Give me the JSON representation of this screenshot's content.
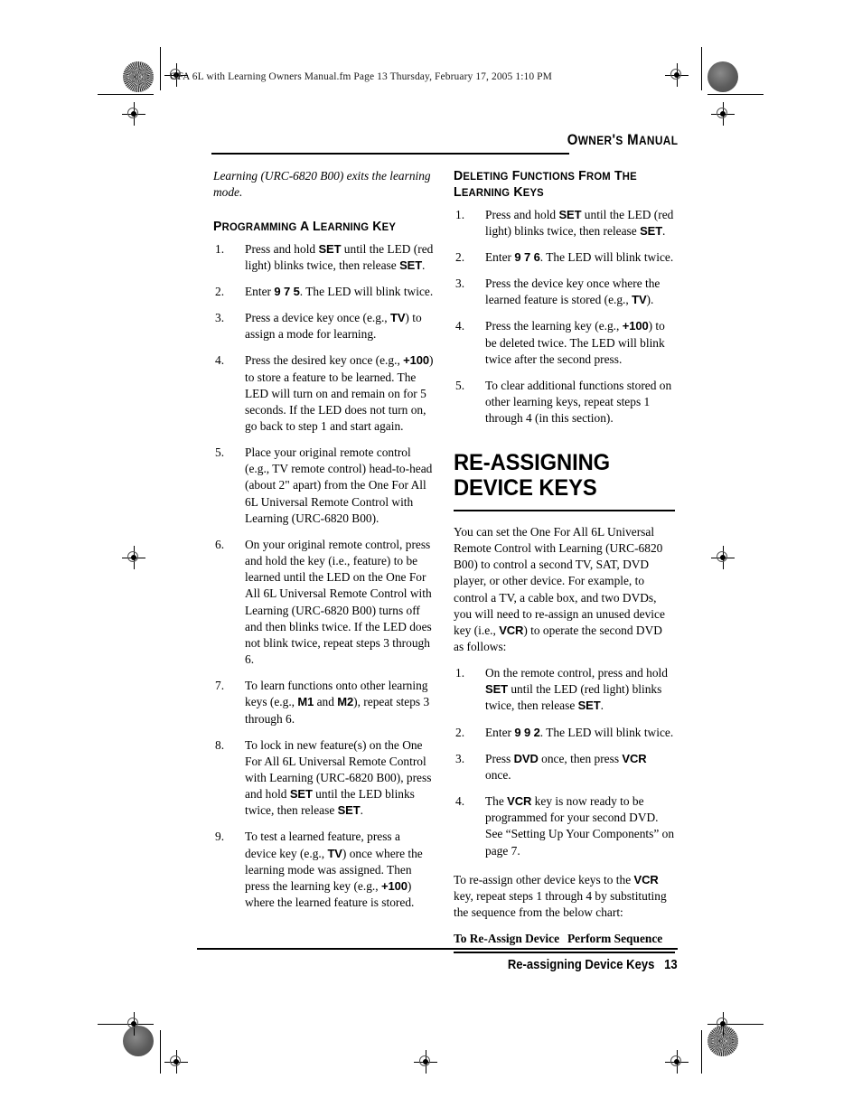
{
  "page": {
    "file_header": "OFA 6L with Learning Owners Manual.fm  Page 13  Thursday, February 17, 2005  1:10 PM",
    "running_head": "Owner's Manual",
    "footer_section": "Re-assigning Device Keys",
    "footer_page_number": "13"
  },
  "left_column": {
    "intro_italic": "Learning (URC-6820 B00) exits the learning mode.",
    "subhead": "Programming a Learning Key",
    "steps": [
      {
        "num": "1.",
        "parts": [
          {
            "t": "Press and hold "
          },
          {
            "t": "SET",
            "k": true
          },
          {
            "t": " until the LED (red light) blinks twice, then release "
          },
          {
            "t": "SET",
            "k": true
          },
          {
            "t": "."
          }
        ]
      },
      {
        "num": "2.",
        "parts": [
          {
            "t": "Enter "
          },
          {
            "t": "9 7 5",
            "k": true
          },
          {
            "t": ". The LED will blink twice."
          }
        ]
      },
      {
        "num": "3.",
        "parts": [
          {
            "t": "Press a device key once (e.g., "
          },
          {
            "t": "TV",
            "k": true
          },
          {
            "t": ") to assign a mode for learning."
          }
        ]
      },
      {
        "num": "4.",
        "parts": [
          {
            "t": "Press the desired key once (e.g., "
          },
          {
            "t": "+100",
            "k": true
          },
          {
            "t": ") to store a feature to be learned. The LED will turn on and remain on for 5 seconds. If the LED does not turn on, go back to step 1 and start again."
          }
        ]
      },
      {
        "num": "5.",
        "parts": [
          {
            "t": "Place your original remote control (e.g., TV remote control) head-to-head (about 2\" apart) from the One For All 6L Universal Remote Control with Learning (URC-6820 B00)."
          }
        ]
      },
      {
        "num": "6.",
        "parts": [
          {
            "t": "On your original remote control, press and hold the key (i.e., feature) to be learned until the LED on the One For All 6L Universal Remote Control with Learning (URC-6820 B00) turns off and then blinks twice. If the LED does not blink twice, repeat steps 3 through 6."
          }
        ]
      },
      {
        "num": "7.",
        "parts": [
          {
            "t": "To learn functions onto other learning keys (e.g., "
          },
          {
            "t": "M1",
            "k": true
          },
          {
            "t": " and "
          },
          {
            "t": "M2",
            "k": true
          },
          {
            "t": "), repeat steps 3 through 6."
          }
        ]
      },
      {
        "num": "8.",
        "parts": [
          {
            "t": "To lock in new feature(s) on the One For All 6L Universal Remote Control with Learning (URC-6820 B00), press and hold "
          },
          {
            "t": "SET",
            "k": true
          },
          {
            "t": " until the LED blinks twice, then release "
          },
          {
            "t": "SET",
            "k": true
          },
          {
            "t": "."
          }
        ]
      },
      {
        "num": "9.",
        "parts": [
          {
            "t": "To test a learned feature, press a device key (e.g., "
          },
          {
            "t": "TV",
            "k": true
          },
          {
            "t": ") once where the learning mode was assigned. Then press the learning key (e.g., "
          },
          {
            "t": "+100",
            "k": true
          },
          {
            "t": ") where the learned feature is stored."
          }
        ]
      }
    ]
  },
  "right_column": {
    "subhead": "Deleting Functions from the Learning Keys",
    "delete_steps": [
      {
        "num": "1.",
        "parts": [
          {
            "t": "Press and hold "
          },
          {
            "t": "SET",
            "k": true
          },
          {
            "t": " until the LED (red light) blinks twice, then release "
          },
          {
            "t": "SET",
            "k": true
          },
          {
            "t": "."
          }
        ]
      },
      {
        "num": "2.",
        "parts": [
          {
            "t": "Enter "
          },
          {
            "t": "9 7 6",
            "k": true
          },
          {
            "t": ". The LED will blink twice."
          }
        ]
      },
      {
        "num": "3.",
        "parts": [
          {
            "t": "Press the device key once where the learned feature is stored (e.g., "
          },
          {
            "t": "TV",
            "k": true
          },
          {
            "t": ")."
          }
        ]
      },
      {
        "num": "4.",
        "parts": [
          {
            "t": "Press the learning key (e.g., "
          },
          {
            "t": "+100",
            "k": true
          },
          {
            "t": ") to be deleted twice. The LED will blink twice after the second press."
          }
        ]
      },
      {
        "num": "5.",
        "parts": [
          {
            "t": "To clear additional functions stored on other learning keys, repeat steps 1 through 4 (in this section)."
          }
        ]
      }
    ],
    "main_heading": "RE-ASSIGNING DEVICE KEYS",
    "intro_paragraph": [
      {
        "t": "You can set the One For All 6L Universal Remote Control with Learning (URC-6820 B00) to control a second TV, SAT, DVD player, or other device. For example, to control a TV, a cable box, and two DVDs, you will need to re-assign an unused device key (i.e., "
      },
      {
        "t": "VCR",
        "k": true
      },
      {
        "t": ") to operate the second DVD as follows:"
      }
    ],
    "reassign_steps": [
      {
        "num": "1.",
        "parts": [
          {
            "t": "On the remote control, press and hold "
          },
          {
            "t": "SET",
            "k": true
          },
          {
            "t": " until the LED (red light) blinks twice, then release "
          },
          {
            "t": "SET",
            "k": true
          },
          {
            "t": "."
          }
        ]
      },
      {
        "num": "2.",
        "parts": [
          {
            "t": "Enter "
          },
          {
            "t": "9 9 2",
            "k": true
          },
          {
            "t": ". The LED will blink twice."
          }
        ]
      },
      {
        "num": "3.",
        "parts": [
          {
            "t": "Press "
          },
          {
            "t": "DVD",
            "k": true
          },
          {
            "t": " once, then press "
          },
          {
            "t": "VCR",
            "k": true
          },
          {
            "t": " once."
          }
        ]
      },
      {
        "num": "4.",
        "parts": [
          {
            "t": "The "
          },
          {
            "t": "VCR",
            "k": true
          },
          {
            "t": " key is now ready to be programmed for your second DVD. See “Setting Up Your Components” on page 7."
          }
        ]
      }
    ],
    "closing_paragraph": [
      {
        "t": "To re-assign other device keys to the "
      },
      {
        "t": "VCR",
        "k": true
      },
      {
        "t": " key, repeat steps 1 through 4 by substituting the sequence from the below chart:"
      }
    ],
    "chart": {
      "header_col1": "To Re-Assign Device",
      "header_col2": "Perform Sequence"
    }
  }
}
